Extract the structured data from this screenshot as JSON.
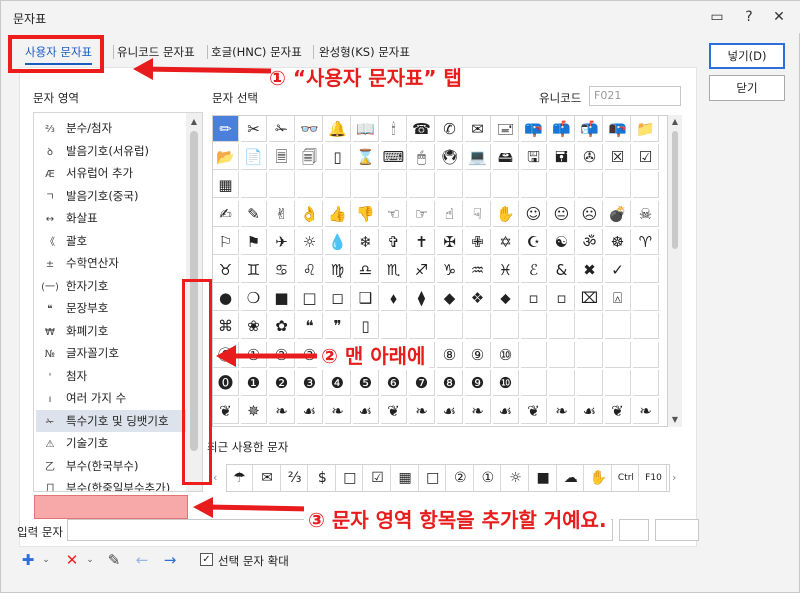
{
  "window": {
    "title": "문자표",
    "controls": [
      "▭",
      "?",
      "✕"
    ]
  },
  "tabs": [
    {
      "label": "사용자 문자표",
      "active": true
    },
    {
      "label": "유니코드 문자표",
      "active": false
    },
    {
      "label": "호글(HNC) 문자표",
      "active": false
    },
    {
      "label": "완성형(KS) 문자표",
      "active": false
    }
  ],
  "buttons": {
    "insert": "넣기(D)",
    "close": "닫기"
  },
  "labels": {
    "category_area": "문자 영역",
    "char_select": "문자 선택",
    "unicode": "유니코드",
    "recent": "최근 사용한 문자",
    "input": "입력 문자",
    "enlarge": "선택 문자 확대"
  },
  "unicode_value": "F021",
  "categories": [
    {
      "icon": "⅔",
      "label": "분수/첨자"
    },
    {
      "icon": "ꝺ",
      "label": "발음기호(서유럽)"
    },
    {
      "icon": "Æ",
      "label": "서유럽어 추가"
    },
    {
      "icon": "ㄱ",
      "label": "발음기호(중국)"
    },
    {
      "icon": "↔",
      "label": "화살표"
    },
    {
      "icon": "《",
      "label": "괄호"
    },
    {
      "icon": "±",
      "label": "수학연산자"
    },
    {
      "icon": "(一)",
      "label": "한자기호"
    },
    {
      "icon": "❝",
      "label": "문장부호"
    },
    {
      "icon": "₩",
      "label": "화폐기호"
    },
    {
      "icon": "№",
      "label": "글자꼴기호"
    },
    {
      "icon": "'",
      "label": "첨자"
    },
    {
      "icon": "ı",
      "label": "여러 가지 수"
    },
    {
      "icon": "✁",
      "label": "특수기호 및 딩뱃기호",
      "selected": true
    },
    {
      "icon": "⚠",
      "label": "기술기호"
    },
    {
      "icon": "乙",
      "label": "부수(한국부수)"
    },
    {
      "icon": "⺆",
      "label": "부수(한중일부수추가)"
    }
  ],
  "grid_rows": [
    [
      "✏",
      "✂",
      "✁",
      "👓",
      "🔔",
      "📖",
      "🕯",
      "☎",
      "✆",
      "✉",
      "🖃",
      "📪",
      "📫",
      "📬",
      "📭",
      "📁"
    ],
    [
      "📂",
      "📄",
      "🗏",
      "🗐",
      "▯",
      "⌛",
      "⌨",
      "🖱",
      "🖲",
      "💻",
      "🖴",
      "🖫",
      "🖬",
      "✇",
      "☒",
      "☑"
    ],
    [
      "▦",
      "",
      "",
      "",
      "",
      "",
      "",
      "",
      "",
      "",
      "",
      "",
      "",
      "",
      "",
      ""
    ],
    [
      "✍",
      "✎",
      "✌",
      "👌",
      "👍",
      "👎",
      "☜",
      "☞",
      "☝",
      "☟",
      "✋",
      "☺",
      "😐",
      "☹",
      "💣",
      "☠"
    ],
    [
      "⚐",
      "⚑",
      "✈",
      "☼",
      "💧",
      "❄",
      "✞",
      "✝",
      "✠",
      "✙",
      "✡",
      "☪",
      "☯",
      "ॐ",
      "☸",
      "♈"
    ],
    [
      "♉",
      "♊",
      "♋",
      "♌",
      "♍",
      "♎",
      "♏",
      "♐",
      "♑",
      "♒",
      "♓",
      "ℰ",
      "&",
      "✖",
      "✓",
      ""
    ],
    [
      "●",
      "❍",
      "■",
      "□",
      "◻",
      "❑",
      "⬧",
      "⧫",
      "◆",
      "❖",
      "⬥",
      "▫",
      "▫",
      "⌧",
      "⍓",
      ""
    ],
    [
      "⌘",
      "❀",
      "✿",
      "❝",
      "❞",
      "▯",
      "",
      "",
      "",
      "",
      "",
      "",
      "",
      "",
      "",
      ""
    ],
    [
      "⓪",
      "①",
      "②",
      "③",
      "④",
      "⑤",
      "⑥",
      "⑦",
      "⑧",
      "⑨",
      "⑩",
      "",
      "",
      "",
      "",
      ""
    ],
    [
      "⓿",
      "❶",
      "❷",
      "❸",
      "❹",
      "❺",
      "❻",
      "❼",
      "❽",
      "❾",
      "❿",
      "",
      "",
      "",
      "",
      ""
    ],
    [
      "❦",
      "✵",
      "❧",
      "☙",
      "❧",
      "☙",
      "❦",
      "❧",
      "☙",
      "❧",
      "☙",
      "❦",
      "❧",
      "☙",
      "❦",
      "❧"
    ]
  ],
  "recent_chars": [
    "☂",
    "✉",
    "⅔",
    "$",
    "□",
    "☑",
    "▦",
    "□",
    "②",
    "①",
    "☼",
    "■",
    "☁",
    "✋",
    "Ctrl",
    "F10"
  ],
  "annotations": {
    "step1": "① “사용자 문자표” 탭",
    "step2": "② 맨 아래에",
    "step3": "③ 문자 영역 항목을 추가할 거예요."
  },
  "colors": {
    "accent": "#1c5bc2",
    "annotation": "#e81c1c",
    "selection": "#4a7fdc"
  }
}
